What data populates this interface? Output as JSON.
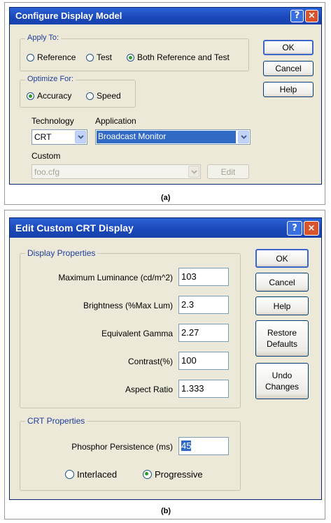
{
  "dialog_a": {
    "title": "Configure Display Model",
    "titlebar_buttons": {
      "help": "?",
      "close": "×"
    },
    "apply_to": {
      "legend": "Apply To:",
      "options": [
        {
          "label": "Reference",
          "selected": false
        },
        {
          "label": "Test",
          "selected": false
        },
        {
          "label": "Both Reference and Test",
          "selected": true
        }
      ]
    },
    "optimize_for": {
      "legend": "Optimize For:",
      "options": [
        {
          "label": "Accuracy",
          "selected": true
        },
        {
          "label": "Speed",
          "selected": false
        }
      ]
    },
    "technology": {
      "label": "Technology",
      "value": "CRT"
    },
    "application": {
      "label": "Application",
      "value": "Broadcast Monitor"
    },
    "custom": {
      "label": "Custom",
      "value": "foo.cfg",
      "edit_label": "Edit"
    },
    "buttons": {
      "ok": "OK",
      "cancel": "Cancel",
      "help": "Help"
    },
    "caption": "(a)"
  },
  "dialog_b": {
    "title": "Edit Custom CRT Display",
    "titlebar_buttons": {
      "help": "?",
      "close": "×"
    },
    "display_properties": {
      "legend": "Display Properties",
      "fields": [
        {
          "label": "Maximum Luminance (cd/m^2)",
          "value": "103"
        },
        {
          "label": "Brightness (%Max Lum)",
          "value": "2.3"
        },
        {
          "label": "Equivalent Gamma",
          "value": "2.27"
        },
        {
          "label": "Contrast(%)",
          "value": "100"
        },
        {
          "label": "Aspect Ratio",
          "value": "1.333"
        }
      ]
    },
    "crt_properties": {
      "legend": "CRT Properties",
      "phosphor": {
        "label": "Phosphor Persistence (ms)",
        "value": "45"
      },
      "scan": [
        {
          "label": "Interlaced",
          "selected": false
        },
        {
          "label": "Progressive",
          "selected": true
        }
      ]
    },
    "buttons": {
      "ok": "OK",
      "cancel": "Cancel",
      "help": "Help",
      "restore_defaults": "Restore Defaults",
      "undo_changes": "Undo Changes"
    },
    "caption": "(b)"
  },
  "colors": {
    "titlebar": "#1a47b8",
    "dialog_bg": "#ece9d8",
    "selection": "#316ac5",
    "group_legend": "#1f3c9c",
    "close_button": "#d9542c"
  }
}
